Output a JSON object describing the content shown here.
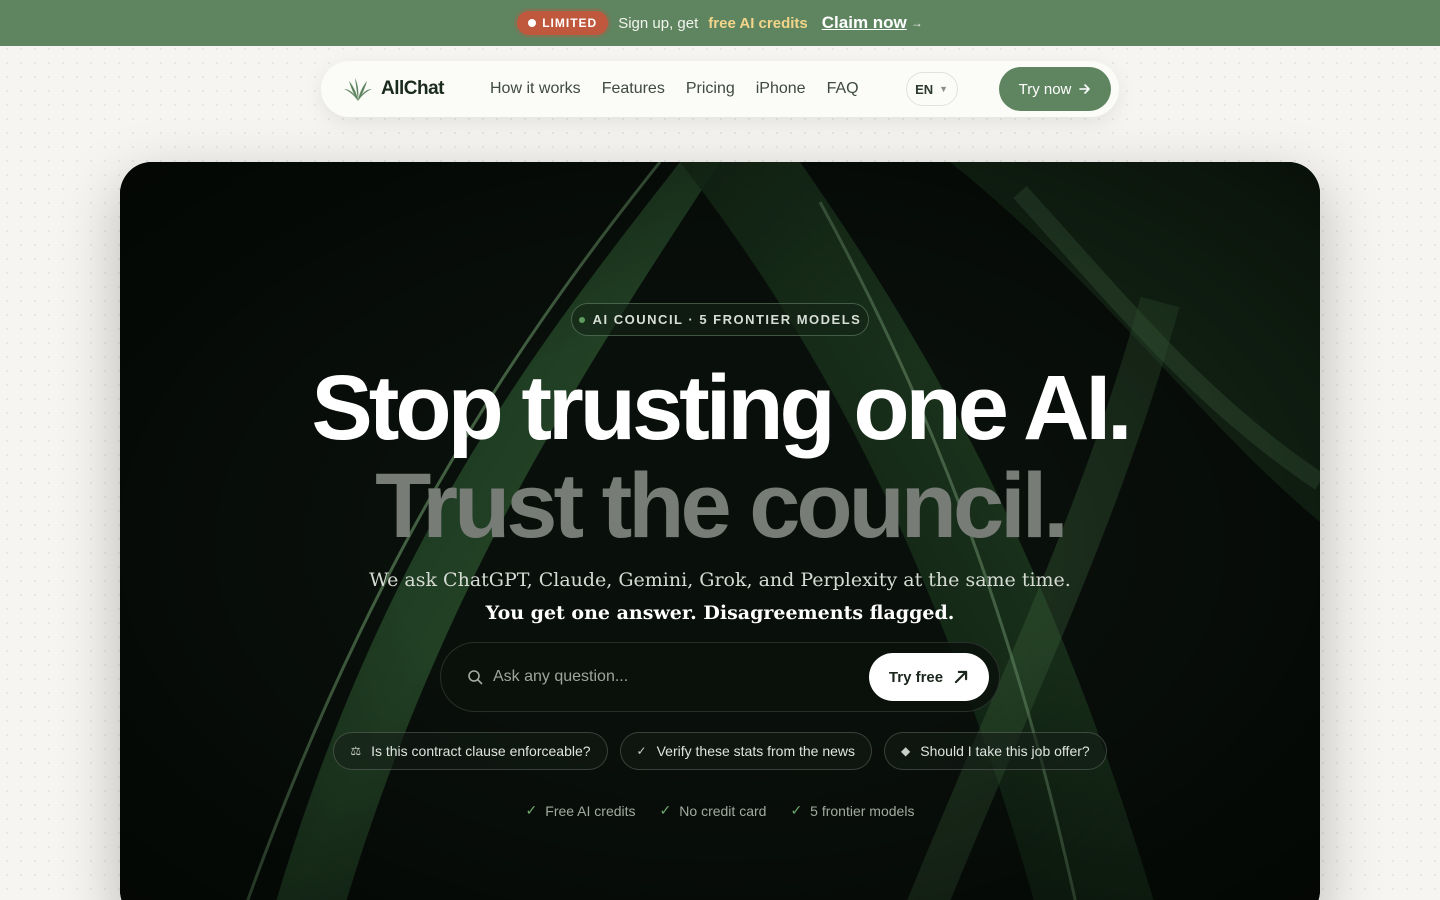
{
  "promo": {
    "badge": "LIMITED",
    "text_before": "Sign up, get",
    "highlight": "free AI credits",
    "cta": "Claim now",
    "cta_arrow": "→"
  },
  "nav": {
    "brand": "AllChat",
    "links": [
      "How it works",
      "Features",
      "Pricing",
      "iPhone",
      "FAQ"
    ],
    "language": "EN",
    "try_label": "Try now"
  },
  "hero": {
    "eyebrow": "AI COUNCIL · 5 FRONTIER MODELS",
    "headline_1": "Stop trusting one AI.",
    "headline_2": "Trust the council.",
    "sub_1": "We ask ChatGPT, Claude, Gemini, Grok, and Perplexity at the same time.",
    "sub_2": "You get one answer. Disagreements flagged.",
    "search_placeholder": "Ask any question...",
    "try_free": "Try free",
    "chips": [
      {
        "icon": "⚖",
        "label": "Is this contract clause enforceable?"
      },
      {
        "icon": "✓",
        "label": "Verify these stats from the news"
      },
      {
        "icon": "◆",
        "label": "Should I take this job offer?"
      }
    ],
    "perks": [
      "Free AI credits",
      "No credit card",
      "5 frontier models"
    ]
  },
  "colors": {
    "brand_green": "#5e8560",
    "promo_badge": "#c0583d",
    "highlight": "#f3d58a",
    "hero_bg": "#0b130d"
  }
}
